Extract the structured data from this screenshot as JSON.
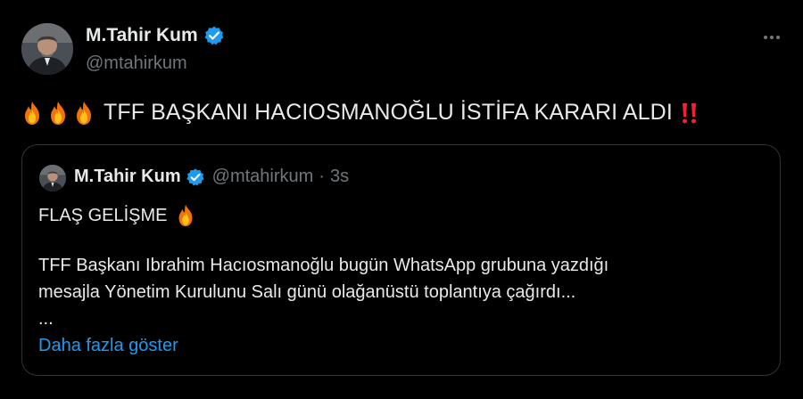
{
  "author": {
    "name": "M.Tahir Kum",
    "handle": "@mtahirkum"
  },
  "tweet": {
    "text": "TFF BAŞKANI HACIOSMANOĞLU İSTİFA KARARI ALDI"
  },
  "quoted": {
    "name": "M.Tahir Kum",
    "handle": "@mtahirkum",
    "separator": "·",
    "time": "3s",
    "headline": "FLAŞ GELİŞME",
    "paragraph_line1": "TFF Başkanı Ibrahim Hacıosmanoğlu bugün WhatsApp grubuna yazdığı",
    "paragraph_line2": "mesajla Yönetim Kurulunu Salı günü olağanüstü toplantıya çağırdı...",
    "ellipsis": "...",
    "show_more": "Daha fazla göster"
  },
  "icons": [
    "avatar",
    "verified-badge-icon",
    "more-options-icon",
    "fire-emoji-icon",
    "double-exclamation-emoji-icon"
  ],
  "colors": {
    "background": "#000000",
    "text": "#e7e9ea",
    "secondary": "#71767b",
    "accent": "#1d9bf0",
    "border": "#2f3336",
    "emoji_red": "#f4212e"
  }
}
